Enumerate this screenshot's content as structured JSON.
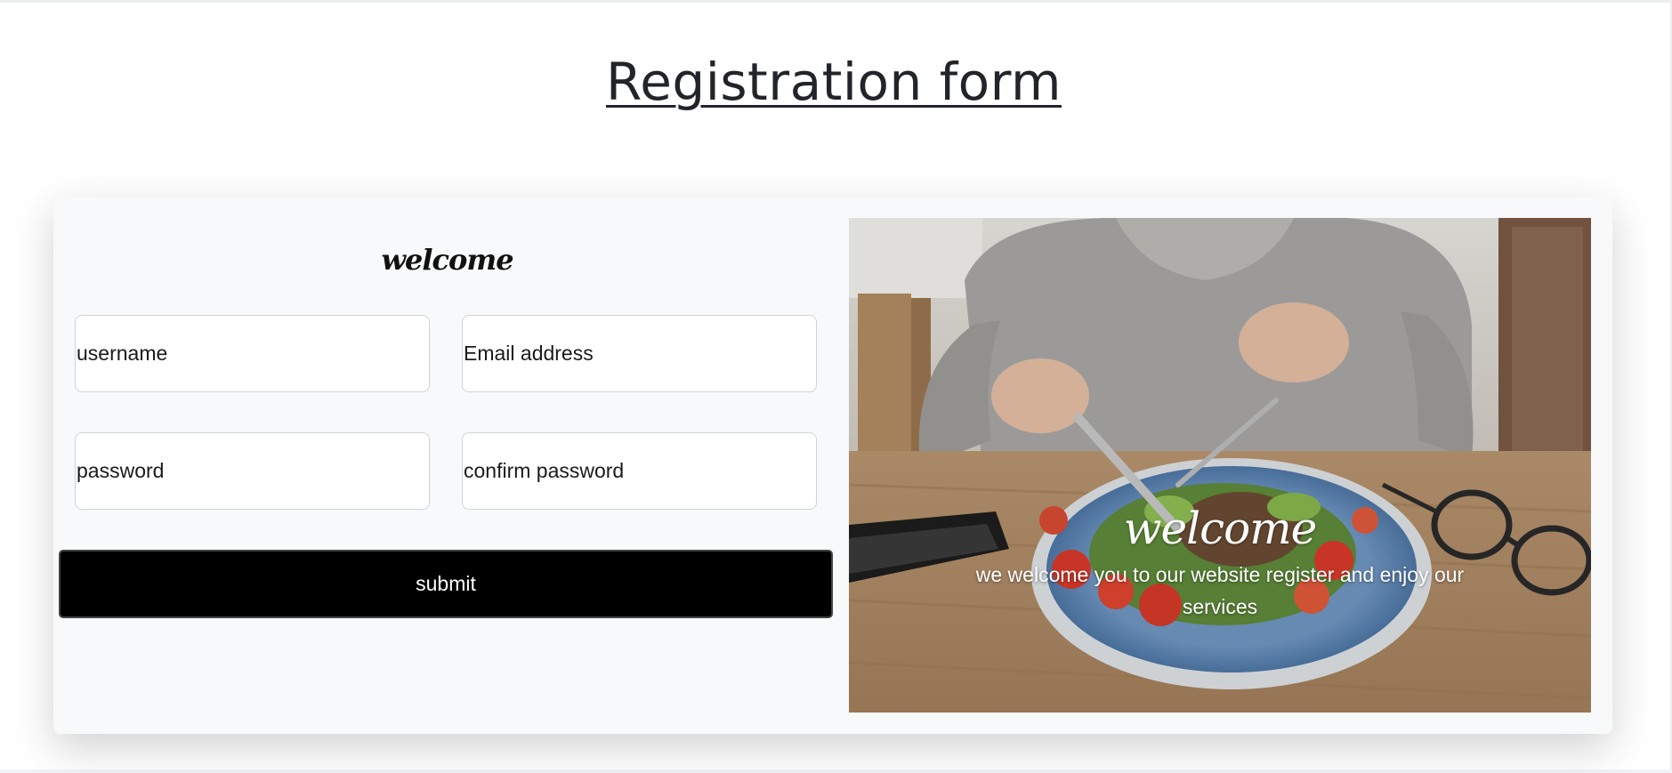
{
  "page": {
    "title": "Registration form"
  },
  "form": {
    "heading": "welcome",
    "fields": {
      "username": {
        "placeholder": "username",
        "value": ""
      },
      "email": {
        "placeholder": "Email address",
        "value": ""
      },
      "password": {
        "placeholder": "password",
        "value": ""
      },
      "confirm_password": {
        "placeholder": "confirm password",
        "value": ""
      }
    },
    "submit_label": "submit"
  },
  "photo": {
    "caption_title": "welcome",
    "caption_text": "we welcome you to our website register and enjoy our services"
  },
  "colors": {
    "card_background": "#f8f9fa",
    "button_background": "#000000",
    "button_text": "#ffffff",
    "title_text": "#212529"
  }
}
